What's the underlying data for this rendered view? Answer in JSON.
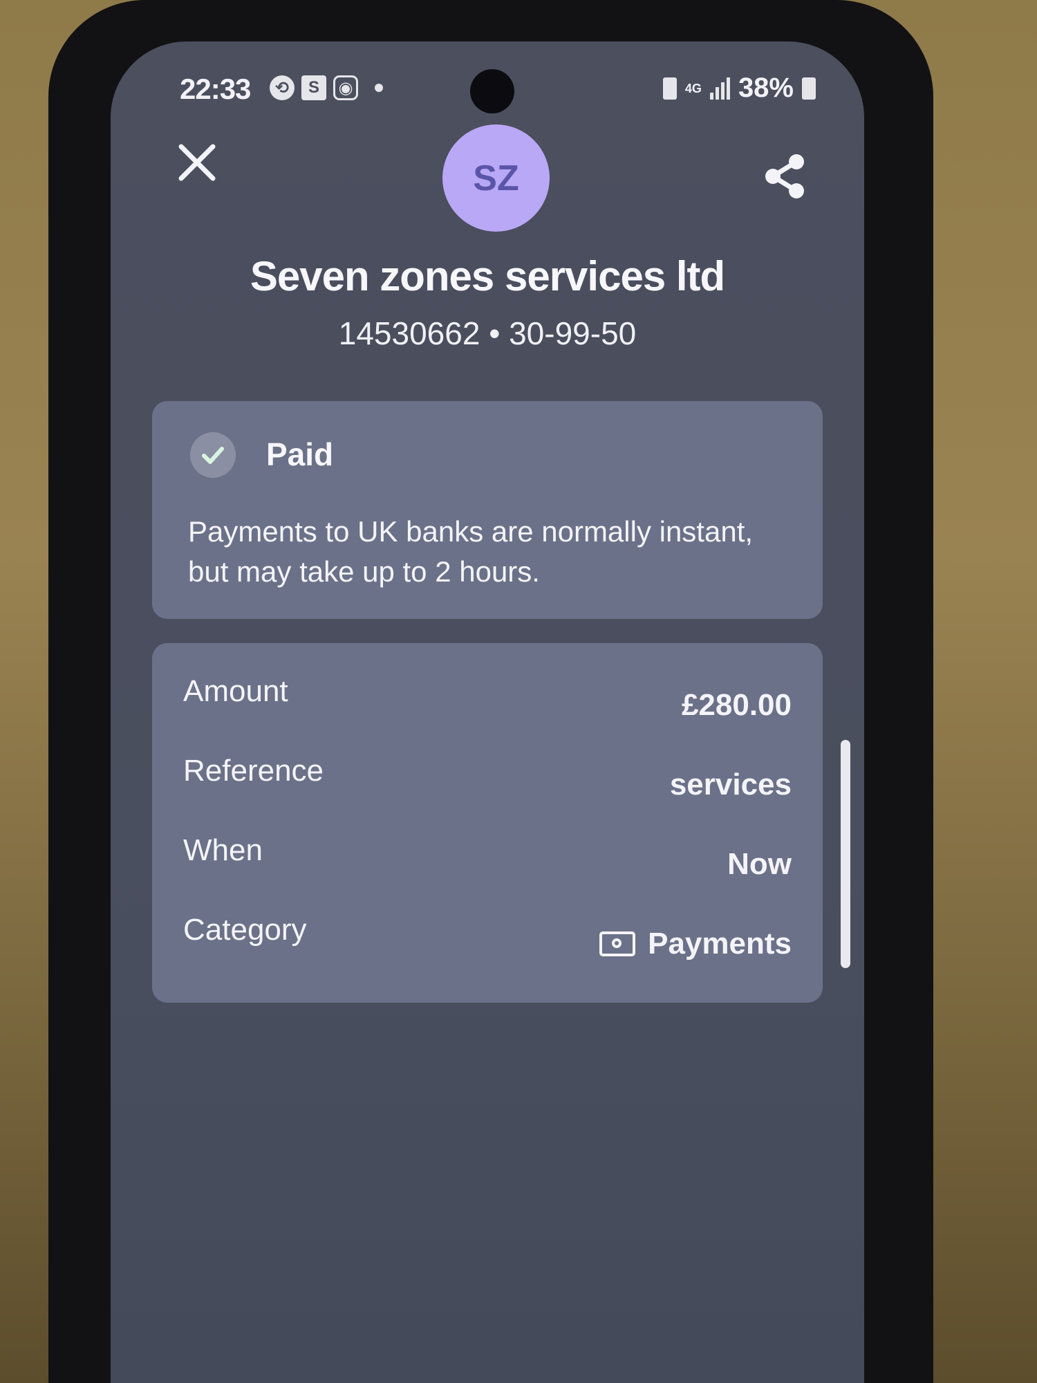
{
  "status_bar": {
    "time": "22:33",
    "battery": "38%",
    "network": "4G",
    "icon_s": "S"
  },
  "header": {
    "avatar_initials": "SZ",
    "payee_name": "Seven zones services ltd",
    "account_line": "14530662 • 30-99-50"
  },
  "status_card": {
    "status": "Paid",
    "description": "Payments to UK banks are normally instant, but may take up to 2 hours."
  },
  "details": {
    "amount_label": "Amount",
    "amount_value": "£280.00",
    "reference_label": "Reference",
    "reference_value": "services",
    "when_label": "When",
    "when_value": "Now",
    "category_label": "Category",
    "category_value": "Payments"
  },
  "colors": {
    "avatar_bg": "#b9a8f5",
    "card_bg": "#6b7188",
    "screen_bg": "#4b4f5e",
    "check": "#d8f5e0"
  },
  "icons": [
    "close-icon",
    "share-icon",
    "check-icon",
    "category-payments-icon"
  ]
}
